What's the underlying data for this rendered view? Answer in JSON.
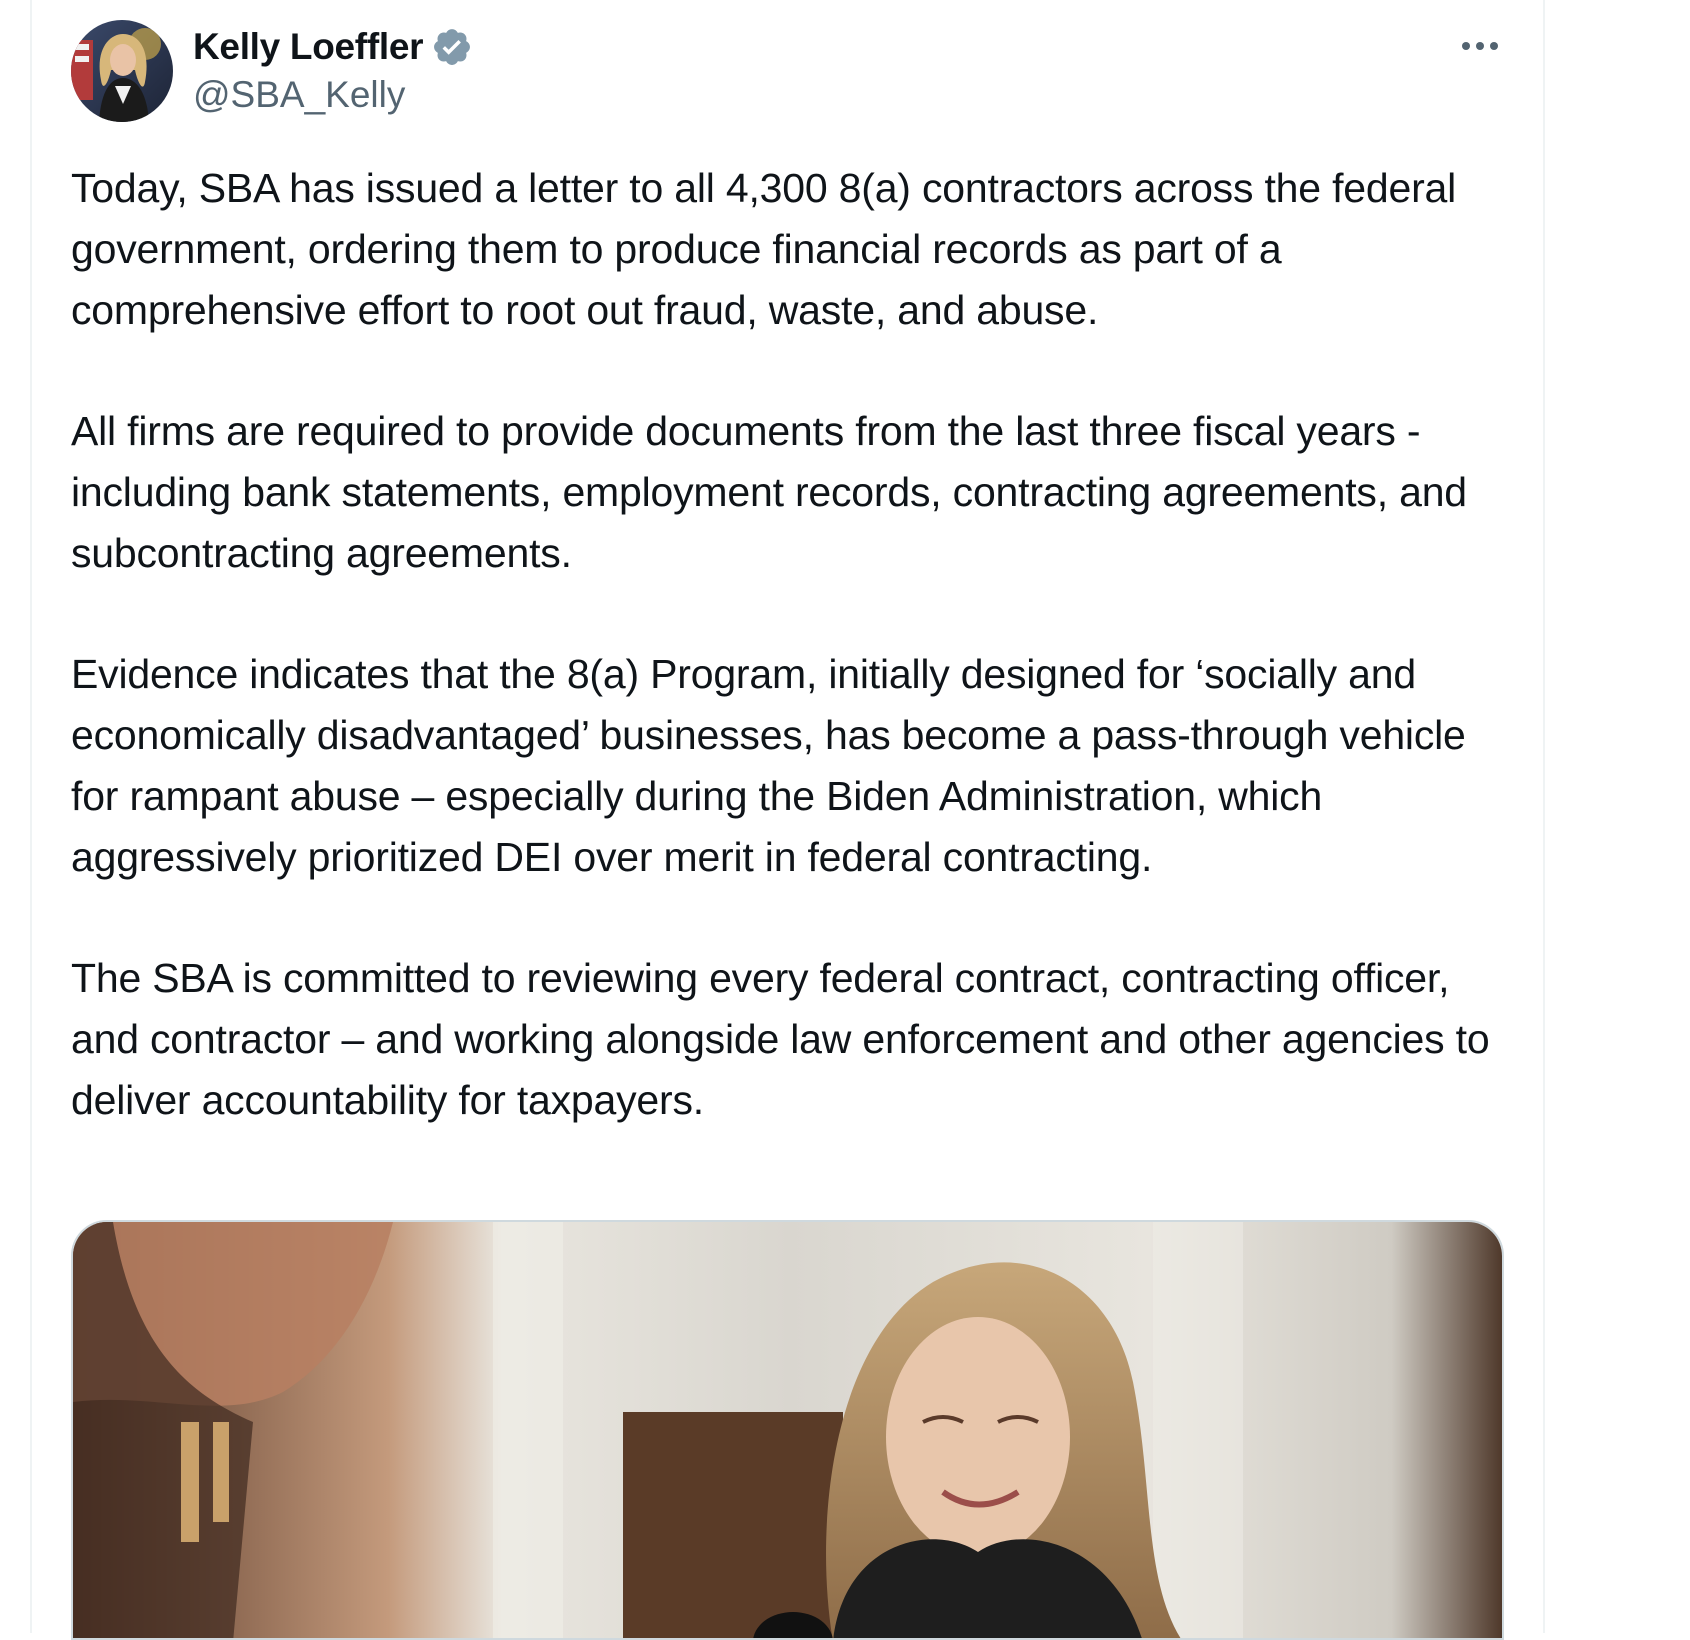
{
  "author": {
    "display_name": "Kelly Loeffler",
    "handle": "@SBA_Kelly",
    "verified_icon": "verified-badge-icon",
    "avatar_icon": "avatar"
  },
  "tweet": {
    "paragraphs": [
      "Today, SBA has issued a letter to all 4,300 8(a) contractors across the federal government, ordering them to produce financial records as part of a comprehensive effort to root out fraud, waste, and abuse.",
      "All firms are required to provide documents from the last three fiscal years - including bank statements, employment records, contracting agreements, and subcontracting agreements.",
      "Evidence indicates that the 8(a) Program, initially designed for ‘socially and economically disadvantaged’ businesses, has become a pass-through vehicle for rampant abuse – especially during the Biden Administration, which aggressively prioritized DEI over merit in federal contracting.",
      "The SBA is committed to reviewing every federal contract, contracting officer, and contractor – and working alongside law enforcement and other agencies to deliver accountability for taxpayers."
    ]
  },
  "menu": {
    "icon": "more-options-icon"
  },
  "colors": {
    "text": "#0f1419",
    "secondary": "#536471",
    "verified": "#829aab",
    "border": "#cfd9de"
  }
}
